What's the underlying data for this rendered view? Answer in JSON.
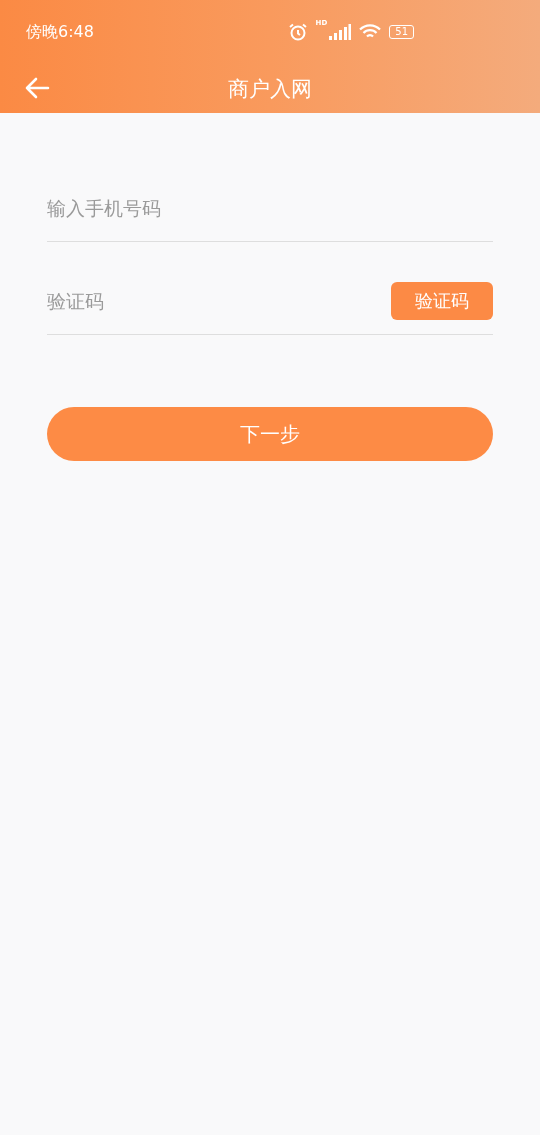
{
  "status_bar": {
    "time": "傍晚6:48",
    "network": "HD",
    "battery": "51"
  },
  "header": {
    "title": "商户入网"
  },
  "form": {
    "fields": [
      {
        "kind": "phone",
        "placeholder": "输入手机号码"
      },
      {
        "kind": "code",
        "placeholder": "验证码",
        "action": "验证码"
      }
    ],
    "submit": "下一步"
  }
}
